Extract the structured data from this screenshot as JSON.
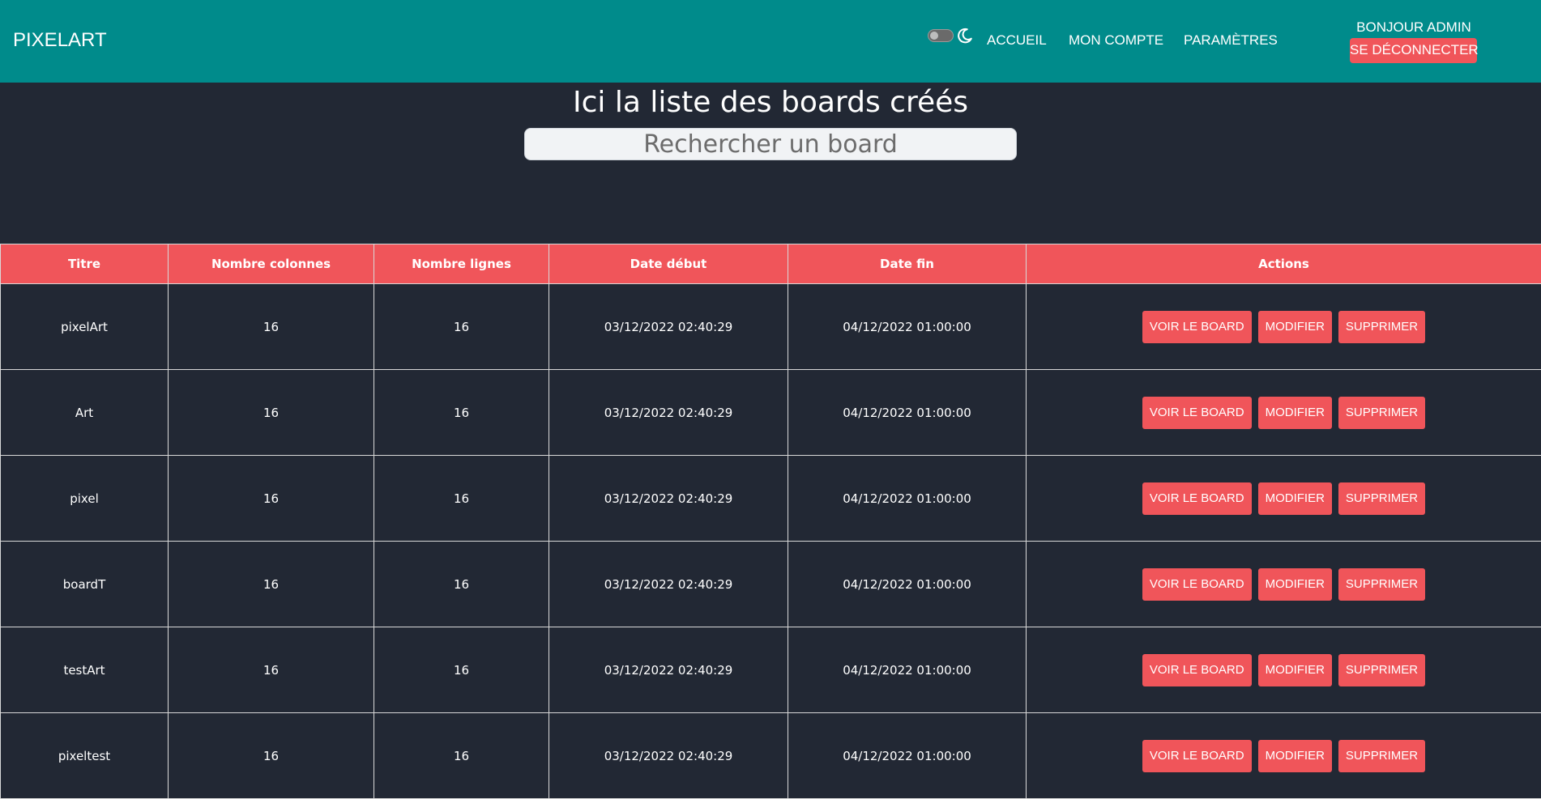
{
  "header": {
    "brand": "PIXELART",
    "nav": {
      "accueil": "ACCUEIL",
      "compte": "MON COMPTE",
      "parametres": "PARAMÈTRES"
    },
    "greeting": "BONJOUR ADMIN",
    "logout_label": "SE DÉCONNECTER",
    "theme_toggle_icon": "toggle-switch",
    "theme_icon": "moon-icon"
  },
  "main": {
    "title": "Ici la liste des boards créés",
    "search_placeholder": "Rechercher un board"
  },
  "table": {
    "columns": [
      "Titre",
      "Nombre colonnes",
      "Nombre lignes",
      "Date début",
      "Date fin",
      "Actions"
    ],
    "action_labels": {
      "view": "VOIR LE BOARD",
      "edit": "MODIFIER",
      "delete": "SUPPRIMER"
    },
    "rows": [
      {
        "title": "pixelArt",
        "cols": "16",
        "rows": "16",
        "start": "03/12/2022 02:40:29",
        "end": "04/12/2022 01:00:00"
      },
      {
        "title": "Art",
        "cols": "16",
        "rows": "16",
        "start": "03/12/2022 02:40:29",
        "end": "04/12/2022 01:00:00"
      },
      {
        "title": "pixel",
        "cols": "16",
        "rows": "16",
        "start": "03/12/2022 02:40:29",
        "end": "04/12/2022 01:00:00"
      },
      {
        "title": "boardT",
        "cols": "16",
        "rows": "16",
        "start": "03/12/2022 02:40:29",
        "end": "04/12/2022 01:00:00"
      },
      {
        "title": "testArt",
        "cols": "16",
        "rows": "16",
        "start": "03/12/2022 02:40:29",
        "end": "04/12/2022 01:00:00"
      },
      {
        "title": "pixeltest",
        "cols": "16",
        "rows": "16",
        "start": "03/12/2022 02:40:29",
        "end": "04/12/2022 01:00:00"
      }
    ]
  },
  "colors": {
    "navbar": "#008b8b",
    "background": "#222834",
    "accent": "#f0555a"
  }
}
